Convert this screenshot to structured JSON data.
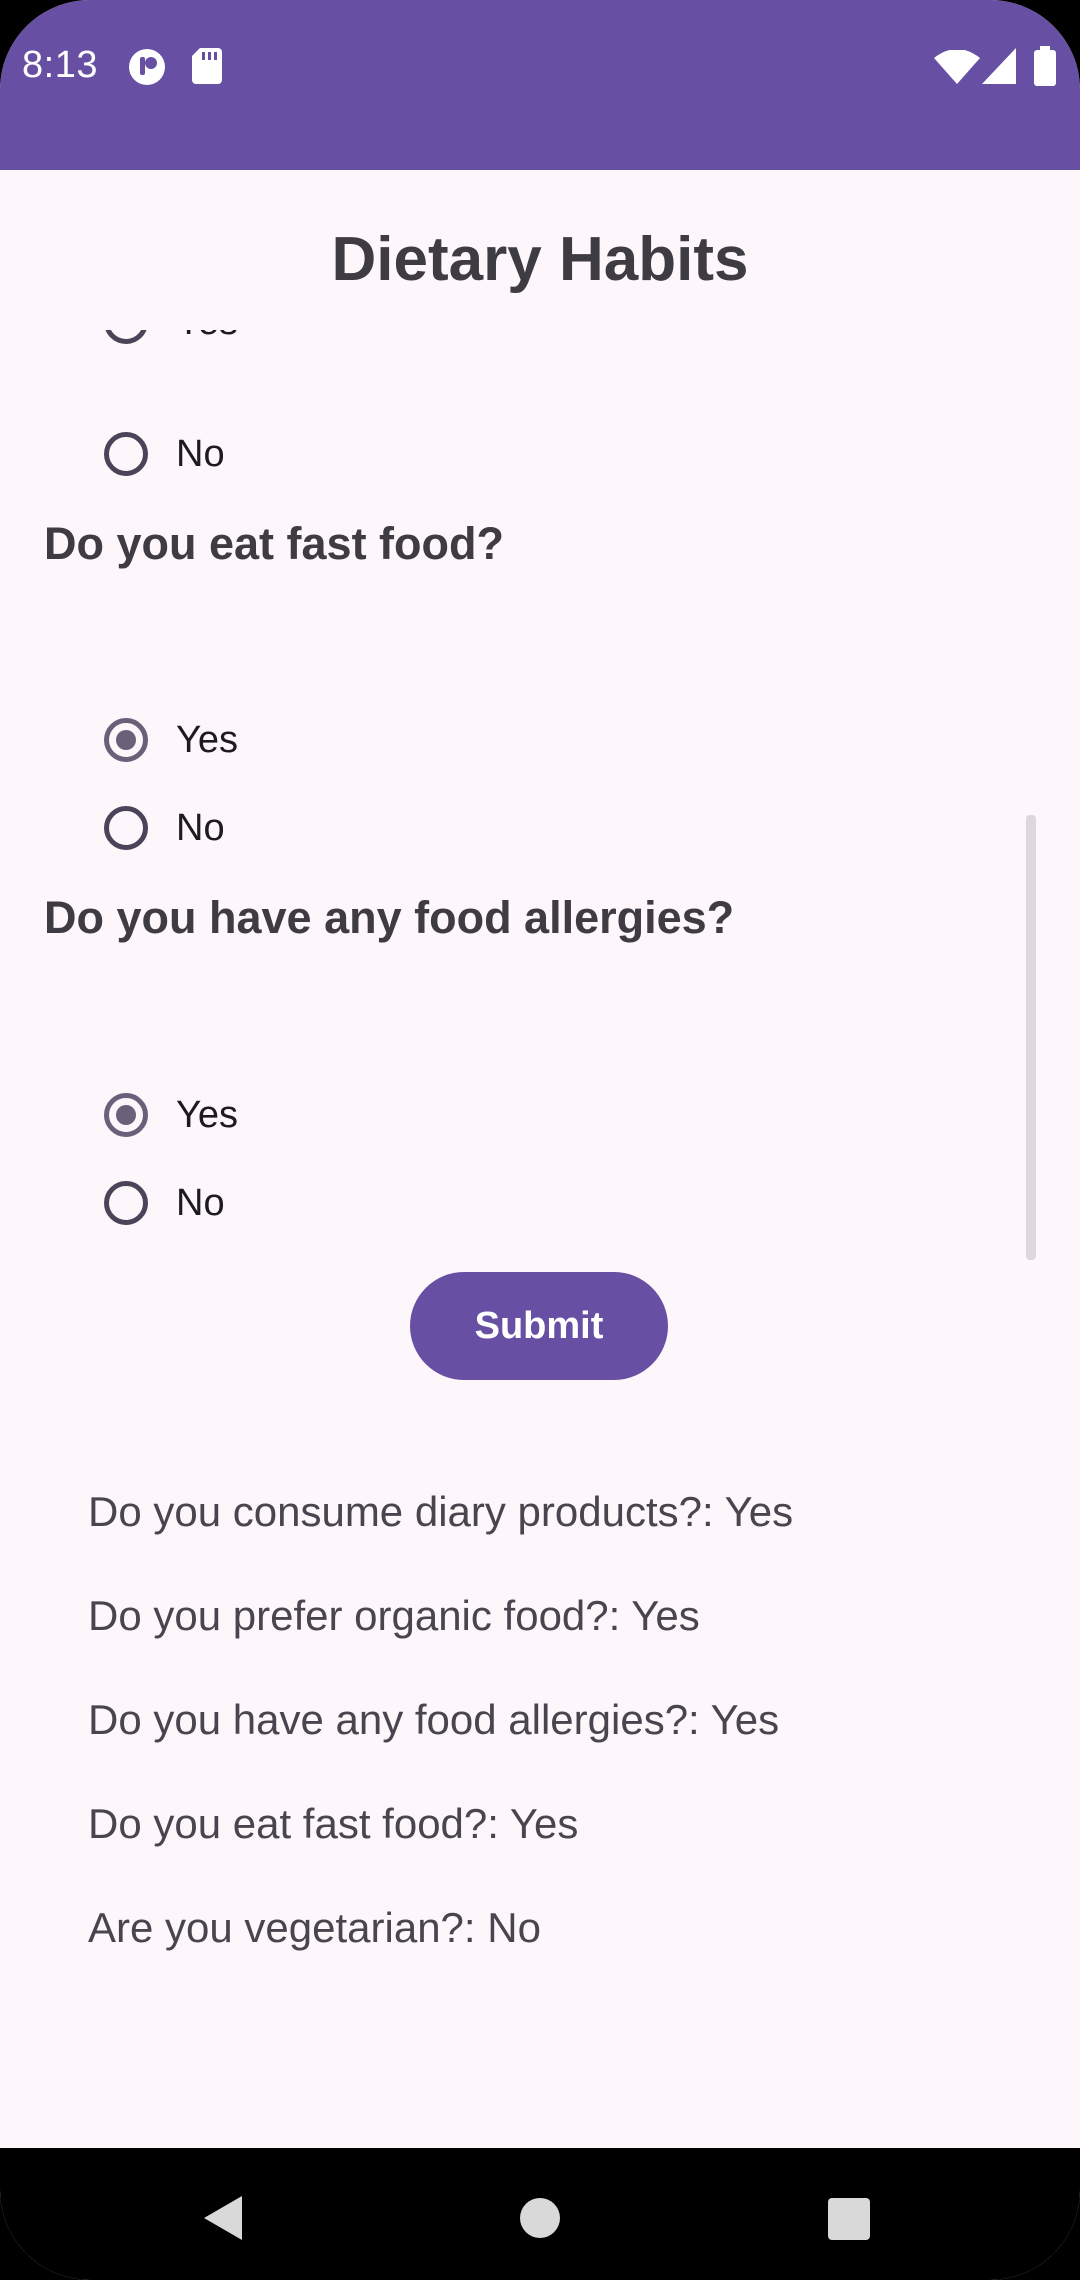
{
  "status_bar": {
    "time": "8:13",
    "icons_left": [
      "notification-app-icon",
      "sd-card-icon"
    ],
    "icons_right": [
      "wifi-icon",
      "cell-signal-icon",
      "battery-icon"
    ],
    "color": "#6750a4"
  },
  "page": {
    "title": "Dietary Habits"
  },
  "form": {
    "partial_group": {
      "options": [
        {
          "label": "Yes",
          "checked": false
        },
        {
          "label": "No",
          "checked": false
        }
      ]
    },
    "questions": [
      {
        "text": "Do you eat fast food?",
        "options": [
          {
            "label": "Yes",
            "checked": true
          },
          {
            "label": "No",
            "checked": false
          }
        ]
      },
      {
        "text": "Do you have any food allergies?",
        "options": [
          {
            "label": "Yes",
            "checked": true
          },
          {
            "label": "No",
            "checked": false
          }
        ]
      }
    ],
    "submit_label": "Submit"
  },
  "results": [
    "Do you consume diary products?: Yes",
    "Do you prefer organic food?: Yes",
    "Do you have any food allergies?: Yes",
    "Do you eat fast food?: Yes",
    "Are you vegetarian?: No"
  ]
}
